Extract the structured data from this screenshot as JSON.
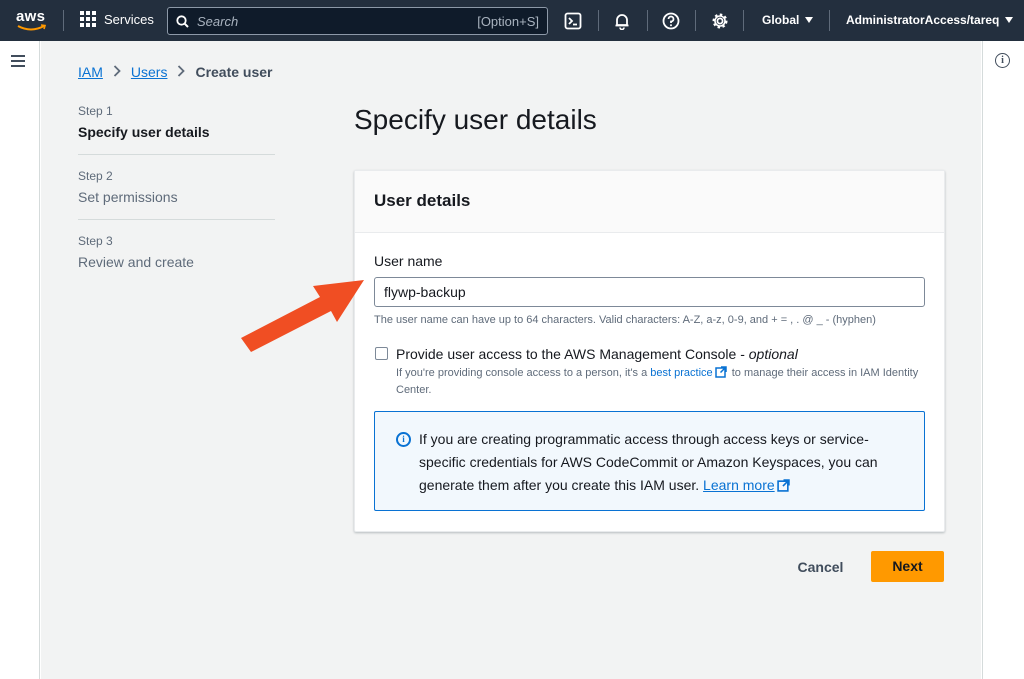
{
  "topbar": {
    "logo_text": "aws",
    "services_label": "Services",
    "search_placeholder": "Search",
    "search_shortcut": "[Option+S]",
    "region_label": "Global",
    "account_label": "AdministratorAccess/tareq",
    "icons": [
      "cloudshell-icon",
      "bell-icon",
      "help-icon",
      "gear-icon"
    ]
  },
  "breadcrumb": {
    "items": [
      "IAM",
      "Users"
    ],
    "current": "Create user"
  },
  "steps": [
    {
      "num": "Step 1",
      "title": "Specify user details",
      "active": true
    },
    {
      "num": "Step 2",
      "title": "Set permissions",
      "active": false
    },
    {
      "num": "Step 3",
      "title": "Review and create",
      "active": false
    }
  ],
  "page_title": "Specify user details",
  "card": {
    "title": "User details",
    "user_name_label": "User name",
    "user_name_value": "flywp-backup",
    "user_name_hint": "The user name can have up to 64 characters. Valid characters: A-Z, a-z, 0-9, and + = , . @ _ - (hyphen)",
    "console_access": {
      "label": "Provide user access to the AWS Management Console - ",
      "optional": "optional",
      "checked": false,
      "desc_before": "If you're providing console access to a person, it's a ",
      "desc_link": "best practice",
      "desc_after": " to manage their access in IAM Identity Center."
    },
    "info": {
      "text": "If you are creating programmatic access through access keys or service-specific credentials for AWS CodeCommit or Amazon Keyspaces, you can generate them after you create this IAM user. ",
      "link": "Learn more"
    }
  },
  "actions": {
    "cancel": "Cancel",
    "next": "Next"
  },
  "colors": {
    "topbar": "#232f3e",
    "primary_button": "#ff9900",
    "link": "#0972d3",
    "annotation_arrow": "#f04e23"
  }
}
